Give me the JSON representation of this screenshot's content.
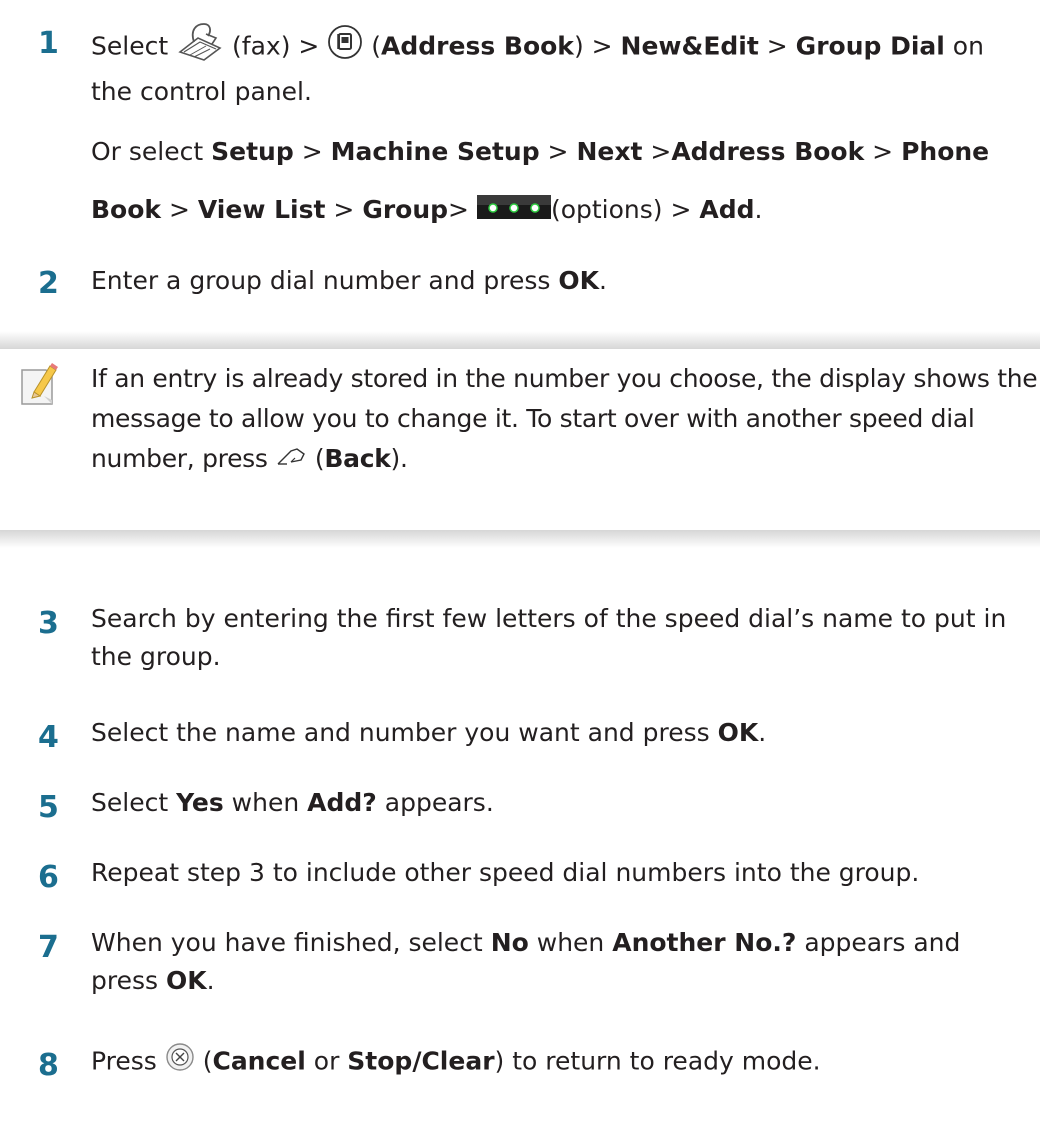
{
  "steps": [
    {
      "number": "1",
      "line1": [
        "Select ",
        "(fax) > ",
        "(",
        "Address Book",
        ") > ",
        "New&Edit",
        " > ",
        "Group Dial",
        " on"
      ],
      "line2": "the control panel.",
      "alt1": [
        "Or select ",
        "Setup",
        " > ",
        "Machine Setup",
        " > ",
        "Next",
        " >",
        "Address Book",
        " > ",
        "Phone"
      ],
      "alt2": [
        "Book",
        " > ",
        "View List",
        " > ",
        "Group",
        ">",
        "(options) > ",
        "Add",
        "."
      ]
    },
    {
      "number": "2",
      "parts": [
        "Enter a group dial number and press ",
        "OK",
        "."
      ]
    },
    {
      "number": "3",
      "line1": "Search by entering the first few letters of the speed dial’s name to put in",
      "line2": "the group."
    },
    {
      "number": "4",
      "parts": [
        "Select the name and number you want and press ",
        "OK",
        "."
      ]
    },
    {
      "number": "5",
      "parts": [
        "Select ",
        "Yes",
        " when ",
        "Add?",
        " appears."
      ]
    },
    {
      "number": "6",
      "text": "Repeat step 3 to include other speed dial numbers into the group."
    },
    {
      "number": "7",
      "line1": [
        "When you have finished, select ",
        "No",
        " when ",
        "Another No.?",
        " appears and"
      ],
      "line2": [
        "press ",
        "OK",
        "."
      ]
    },
    {
      "number": "8",
      "parts": [
        "Press ",
        "(",
        "Cancel",
        " or ",
        "Stop/Clear",
        ") to return to ready mode."
      ]
    }
  ],
  "note": {
    "line1": "If an entry is already stored in the number you choose, the display shows the",
    "line2": "message to allow you to change it. To start over with another speed dial",
    "line3": [
      "number, press ",
      "(",
      "Back",
      ")."
    ]
  },
  "icons": {
    "fax": "fax-icon",
    "address_book": "address-book-icon",
    "options": "options-icon",
    "note": "note-pencil-icon",
    "back": "back-icon",
    "cancel": "cancel-icon"
  },
  "colors": {
    "step_number": "#1b6e8f",
    "note_band": "#d6d6d6",
    "options_button": "#1a1a1a",
    "options_dots": "#2ecc40"
  }
}
